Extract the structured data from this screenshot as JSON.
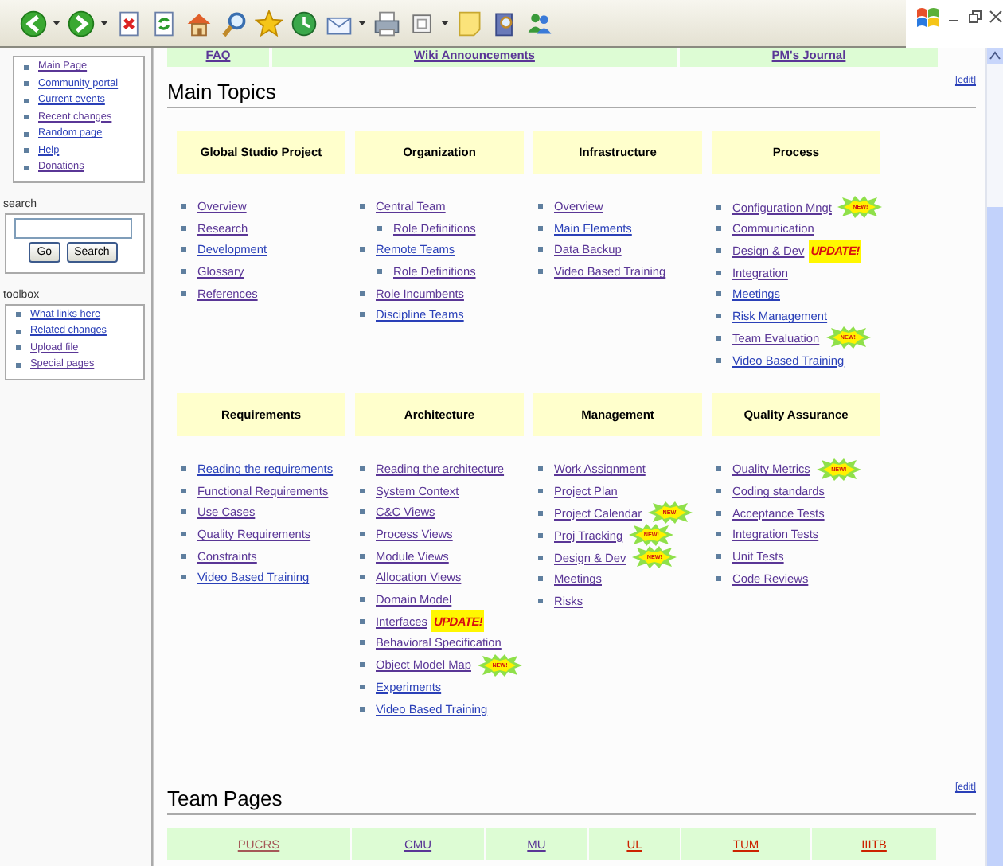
{
  "toolbar": {
    "buttons": [
      {
        "kind": "back",
        "dropdown": true
      },
      {
        "kind": "forward",
        "dropdown": true
      },
      {
        "kind": "stop",
        "dropdown": false
      },
      {
        "kind": "refresh",
        "dropdown": false
      },
      {
        "kind": "home",
        "dropdown": false
      },
      {
        "kind": "search",
        "dropdown": false
      },
      {
        "kind": "favorites",
        "dropdown": false
      },
      {
        "kind": "history",
        "dropdown": false
      },
      {
        "kind": "mail",
        "dropdown": true
      },
      {
        "kind": "print",
        "dropdown": false
      },
      {
        "kind": "edit",
        "dropdown": true
      },
      {
        "kind": "note",
        "dropdown": false
      },
      {
        "kind": "research",
        "dropdown": false
      },
      {
        "kind": "messenger",
        "dropdown": false
      }
    ]
  },
  "sidebar": {
    "navigation": [
      {
        "label": "Main Page",
        "visited": true
      },
      {
        "label": "Community portal",
        "visited": false
      },
      {
        "label": "Current events",
        "visited": false
      },
      {
        "label": "Recent changes",
        "visited": true
      },
      {
        "label": "Random page",
        "visited": false
      },
      {
        "label": "Help",
        "visited": false
      },
      {
        "label": "Donations",
        "visited": true
      }
    ],
    "search": {
      "label": "search",
      "buttons": [
        "Go",
        "Search"
      ]
    },
    "toolbox": {
      "label": "toolbox",
      "items": [
        {
          "label": "What links here",
          "visited": false
        },
        {
          "label": "Related changes",
          "visited": false
        },
        {
          "label": "Upload file",
          "visited": true
        },
        {
          "label": "Special pages",
          "visited": true
        }
      ]
    }
  },
  "links_bar": [
    {
      "label": "FAQ",
      "visited": true
    },
    {
      "label": "Wiki Announcements",
      "visited": true
    },
    {
      "label": "PM's Journal",
      "visited": true
    }
  ],
  "main_topics": {
    "title": "Main Topics",
    "edit": "[edit]",
    "rows": [
      [
        {
          "title": "Global Studio Project",
          "items": [
            {
              "label": "Overview",
              "visited": true
            },
            {
              "label": "Research",
              "visited": true
            },
            {
              "label": "Development",
              "visited": false
            },
            {
              "label": "Glossary",
              "visited": true
            },
            {
              "label": "References",
              "visited": true
            }
          ]
        },
        {
          "title": "Organization",
          "items": [
            {
              "label": "Central Team",
              "visited": true,
              "children": [
                {
                  "label": "Role Definitions",
                  "visited": true
                }
              ]
            },
            {
              "label": "Remote Teams",
              "visited": false,
              "children": [
                {
                  "label": "Role Definitions",
                  "visited": true
                }
              ]
            },
            {
              "label": "Role Incumbents",
              "visited": true
            },
            {
              "label": "Discipline Teams",
              "visited": false
            }
          ]
        },
        {
          "title": "Infrastructure",
          "items": [
            {
              "label": "Overview",
              "visited": true
            },
            {
              "label": "Main Elements",
              "visited": false
            },
            {
              "label": "Data Backup",
              "visited": true
            },
            {
              "label": "Video Based Training",
              "visited": true
            }
          ]
        },
        {
          "title": "Process",
          "items": [
            {
              "label": "Configuration Mngt",
              "visited": true,
              "badge": {
                "kind": "new",
                "text": "NEW!"
              }
            },
            {
              "label": "Communication",
              "visited": true
            },
            {
              "label": "Design & Dev",
              "visited": true,
              "badge": {
                "kind": "update",
                "text": "UPDATE!"
              }
            },
            {
              "label": "Integration",
              "visited": true
            },
            {
              "label": "Meetings",
              "visited": false
            },
            {
              "label": "Risk Management",
              "visited": false
            },
            {
              "label": "Team Evaluation",
              "visited": true,
              "badge": {
                "kind": "new",
                "text": "NEW!"
              }
            },
            {
              "label": "Video Based Training",
              "visited": false
            }
          ]
        }
      ],
      [
        {
          "title": "Requirements",
          "items": [
            {
              "label": "Reading the requirements",
              "visited": false
            },
            {
              "label": "Functional Requirements",
              "visited": true
            },
            {
              "label": "Use Cases",
              "visited": true
            },
            {
              "label": "Quality Requirements",
              "visited": true
            },
            {
              "label": "Constraints",
              "visited": true
            },
            {
              "label": "Video Based Training",
              "visited": false
            }
          ]
        },
        {
          "title": "Architecture",
          "items": [
            {
              "label": "Reading the architecture",
              "visited": true
            },
            {
              "label": "System Context",
              "visited": true
            },
            {
              "label": "C&C Views",
              "visited": true
            },
            {
              "label": "Process Views",
              "visited": true
            },
            {
              "label": "Module Views",
              "visited": true
            },
            {
              "label": "Allocation Views",
              "visited": true
            },
            {
              "label": "Domain Model",
              "visited": true
            },
            {
              "label": "Interfaces",
              "visited": true,
              "badge": {
                "kind": "update",
                "text": "UPDATE!"
              }
            },
            {
              "label": "Behavioral Specification",
              "visited": true
            },
            {
              "label": "Object Model Map",
              "visited": true,
              "badge": {
                "kind": "new",
                "text": "NEW!"
              }
            },
            {
              "label": "Experiments",
              "visited": false
            },
            {
              "label": "Video Based Training",
              "visited": false
            }
          ]
        },
        {
          "title": "Management",
          "items": [
            {
              "label": "Work Assignment",
              "visited": true
            },
            {
              "label": "Project Plan",
              "visited": true
            },
            {
              "label": "Project Calendar",
              "visited": true,
              "badge": {
                "kind": "new",
                "text": "NEW!"
              }
            },
            {
              "label": "Proj Tracking",
              "visited": true,
              "badge": {
                "kind": "new",
                "text": "NEW!"
              }
            },
            {
              "label": "Design & Dev",
              "visited": true,
              "badge": {
                "kind": "new",
                "text": "NEW!"
              }
            },
            {
              "label": "Meetings",
              "visited": true
            },
            {
              "label": "Risks",
              "visited": true
            }
          ]
        },
        {
          "title": "Quality Assurance",
          "items": [
            {
              "label": "Quality Metrics",
              "visited": true,
              "badge": {
                "kind": "new",
                "text": "NEW!"
              }
            },
            {
              "label": "Coding standards",
              "visited": true
            },
            {
              "label": "Acceptance Tests",
              "visited": true
            },
            {
              "label": "Integration Tests",
              "visited": true
            },
            {
              "label": "Unit Tests",
              "visited": true
            },
            {
              "label": "Code Reviews",
              "visited": true
            }
          ]
        }
      ]
    ]
  },
  "team_pages": {
    "title": "Team Pages",
    "edit": "[edit]",
    "teams": [
      {
        "label": "PUCRS",
        "visited": true,
        "missing": true
      },
      {
        "label": "CMU",
        "visited": true,
        "missing": false
      },
      {
        "label": "MU",
        "visited": true,
        "missing": false
      },
      {
        "label": "UL",
        "visited": false,
        "missing": true
      },
      {
        "label": "TUM",
        "visited": false,
        "missing": true
      },
      {
        "label": "IIITB",
        "visited": false,
        "missing": true
      }
    ]
  }
}
